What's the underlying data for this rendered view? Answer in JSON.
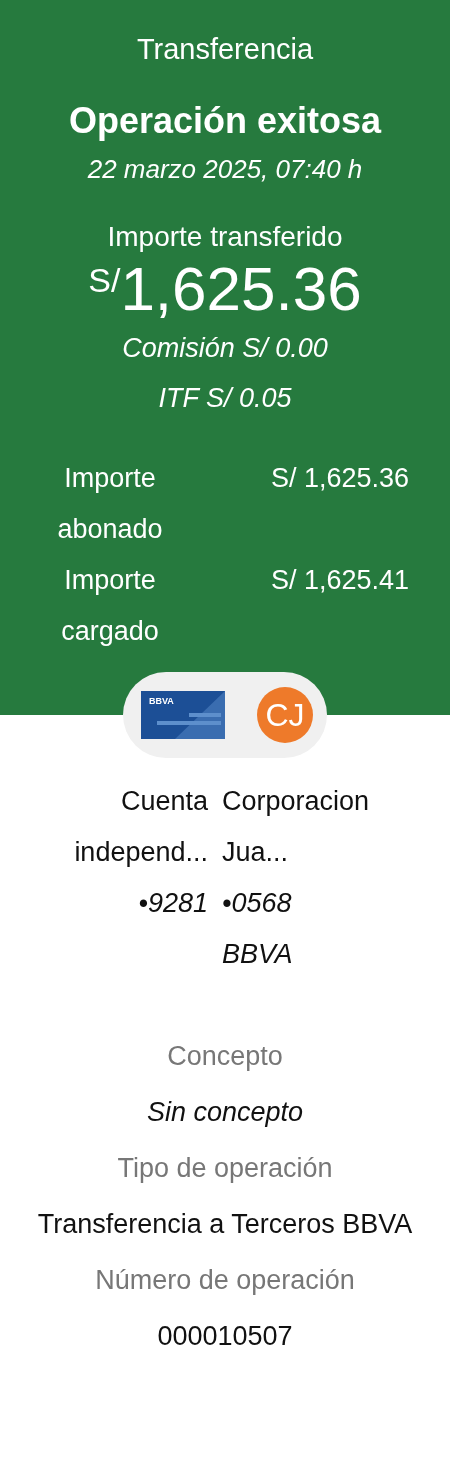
{
  "header": {
    "title": "Transferencia",
    "status": "Operación exitosa",
    "datetime": "22 marzo 2025, 07:40 h",
    "amount_label": "Importe transferido",
    "currency": "S/",
    "amount": "1,625.36",
    "fees": [
      "Comisión S/ 0.00",
      "ITF S/ 0.05"
    ]
  },
  "summary": [
    {
      "label": "Importe abonado",
      "value": "S/ 1,625.36"
    },
    {
      "label": "Importe cargado",
      "value": "S/ 1,625.41"
    }
  ],
  "origin": {
    "card_brand": "BBVA",
    "name": "Cuenta independ...",
    "number": "•9281"
  },
  "destination": {
    "initials": "CJ",
    "name": "Corporacion Jua...",
    "number": "•0568",
    "bank": "BBVA"
  },
  "details": [
    {
      "label": "Concepto",
      "value": "Sin concepto",
      "kind": "italic"
    },
    {
      "label": "Tipo de operación",
      "value": "Transferencia a Terceros BBVA",
      "kind": "plain"
    },
    {
      "label": "Número de operación",
      "value": "000010507",
      "kind": "strong"
    }
  ]
}
